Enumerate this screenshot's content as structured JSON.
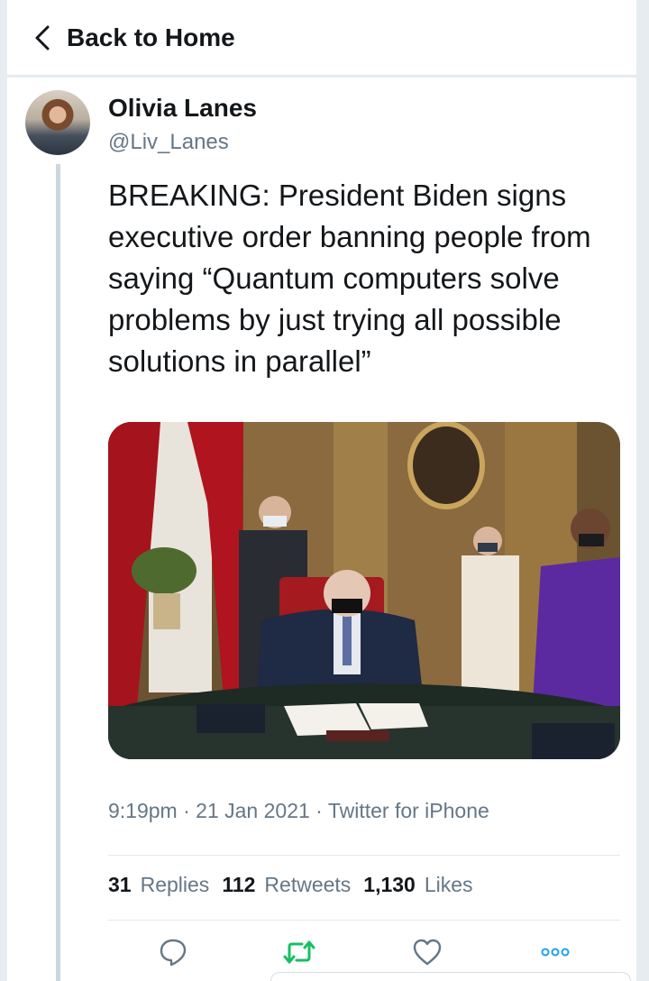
{
  "nav": {
    "back_label": "Back to Home"
  },
  "tweet": {
    "author_name": "Olivia Lanes",
    "author_handle": "@Liv_Lanes",
    "text": "BREAKING: President Biden signs executive order banning people from saying “Quantum computers solve problems by just trying all possible solutions in parallel”",
    "time": "9:19pm",
    "date": "21 Jan 2021",
    "source": "Twitter for iPhone",
    "separator": " · "
  },
  "stats": {
    "replies_count": "31",
    "replies_label": "Replies",
    "retweets_count": "112",
    "retweets_label": "Retweets",
    "likes_count": "1,130",
    "likes_label": "Likes"
  },
  "icons": {
    "back": "chevron-left-icon",
    "reply": "reply-bubble-icon",
    "retweet": "retweet-icon",
    "like": "heart-icon",
    "more": "more-dots-icon"
  },
  "colors": {
    "text": "#14171a",
    "secondary": "#657786",
    "retweet_green": "#17bf63",
    "accent_blue": "#1da1f2",
    "background": "#e6ecf0"
  }
}
